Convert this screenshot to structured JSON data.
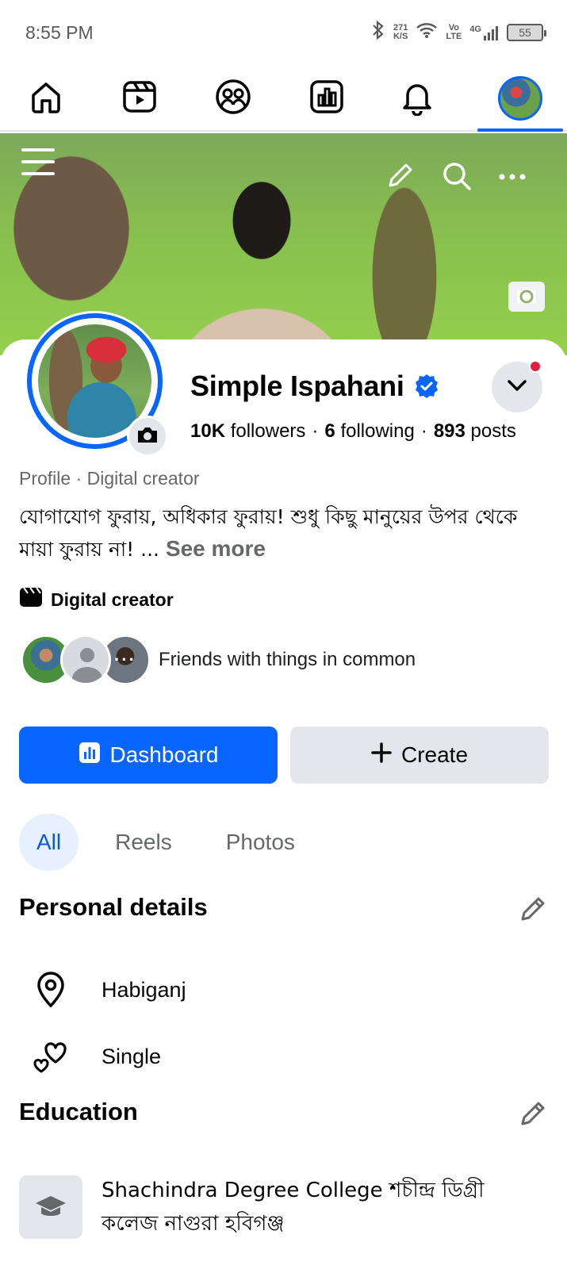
{
  "status_bar": {
    "time": "8:55 PM",
    "speed_value": "271",
    "speed_unit": "K/S",
    "volte_top": "Vo",
    "volte_bottom": "LTE",
    "network": "4G",
    "battery": "55"
  },
  "nav": {
    "items": [
      "home",
      "reels",
      "friends",
      "dashboard",
      "notifications",
      "profile"
    ],
    "active": "profile"
  },
  "profile": {
    "name": "Simple Ispahani",
    "followers_count": "10K",
    "followers_label": "followers",
    "following_count": "6",
    "following_label": "following",
    "posts_count": "893",
    "posts_label": "posts",
    "separator": "·",
    "category": "Profile · Digital creator",
    "bio": "যোগাযোগ ফুরায়, অধিকার ফুরায়! শুধু কিছু মানুয়ের উপর থেকে মায়া ফুরায় না! ...",
    "see_more": "See more",
    "creator_label": "Digital creator",
    "friends_text": "Friends with things in common"
  },
  "actions": {
    "dashboard_label": "Dashboard",
    "create_label": "Create"
  },
  "tabs": [
    {
      "label": "All",
      "active": true
    },
    {
      "label": "Reels",
      "active": false
    },
    {
      "label": "Photos",
      "active": false
    }
  ],
  "personal_details": {
    "title": "Personal details",
    "location": "Habiganj",
    "relationship": "Single"
  },
  "education": {
    "title": "Education",
    "school": "Shachindra Degree College শচীন্দ্র ডিগ্রী কলেজ নাগুরা হবিগঞ্জ"
  },
  "colors": {
    "accent": "#0866ff",
    "gray_button": "#e4e6eb",
    "secondary_text": "#65676b",
    "notification_dot": "#e41e3f"
  }
}
